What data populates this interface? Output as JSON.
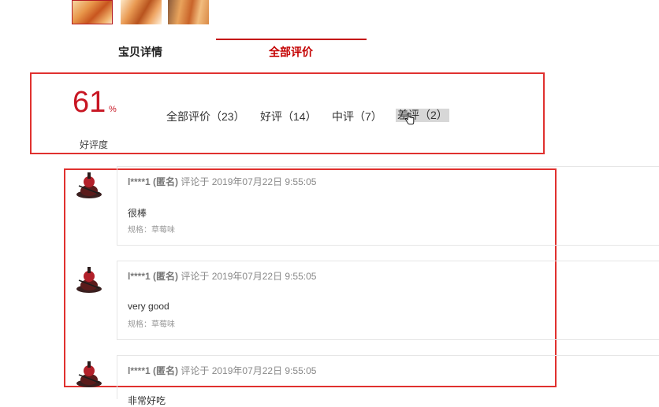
{
  "tabs": {
    "detail": "宝贝详情",
    "reviews": "全部评价"
  },
  "rating": {
    "value": "61",
    "unit": "%",
    "label": "好评度"
  },
  "filters": {
    "all": "全部评价（23）",
    "good": "好评（14）",
    "mid": "中评（7）",
    "bad": "差评（2）"
  },
  "reviews": [
    {
      "user": "l****1 (匿名)",
      "time": "评论于 2019年07月22日 9:55:05",
      "content": "很棒",
      "spec": "规格：草莓味"
    },
    {
      "user": "l****1 (匿名)",
      "time": "评论于 2019年07月22日 9:55:05",
      "content": "very good",
      "spec": "规格：草莓味"
    },
    {
      "user": "l****1 (匿名)",
      "time": "评论于 2019年07月22日 9:55:05",
      "content": "非常好吃",
      "spec": ""
    }
  ],
  "colors": {
    "accent": "#c40000",
    "annotation": "#e0312f"
  }
}
